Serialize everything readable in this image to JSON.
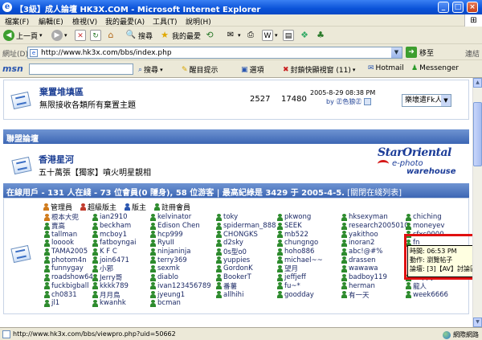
{
  "window": {
    "title": "【3級】成人論壇 HK3X.COM - Microsoft Internet Explorer",
    "buttons": [
      "_",
      "□",
      "×"
    ]
  },
  "menu": [
    "檔案(F)",
    "編輯(E)",
    "檢視(V)",
    "我的最愛(A)",
    "工具(T)",
    "說明(H)"
  ],
  "toolbar": {
    "back": "上一頁",
    "search": "搜尋",
    "favorites": "我的最愛"
  },
  "address": {
    "label": "網址(D)",
    "url": "http://www.hk3x.com/bbs/index.php",
    "go": "移至",
    "links": "連結"
  },
  "msn": {
    "logo": "msn",
    "search": "搜尋",
    "highlight": "醒目提示",
    "options": "選項",
    "popup": "封鎖快顯視窗 (11)",
    "hotmail": "Hotmail",
    "messenger": "Messenger"
  },
  "forums": [
    {
      "title": "棄置堆填區",
      "desc": "無限接收各類所有棄置主題",
      "topics": "2527",
      "posts": "17480",
      "last_time": "2005-8-29 08:38 PM",
      "last_by": "by ㊣色狼㊣",
      "moderator": "樂壞遣Fk人"
    }
  ],
  "section": {
    "title": "聯盟論壇"
  },
  "alliance": {
    "title": "香港星河",
    "desc": "五十萬張【獨家】噴火明星靚相",
    "banner_line1": "StarOriental",
    "banner_line2": "e-photo",
    "banner_line3": "warehouse"
  },
  "online": {
    "header": "在線用戶 - 131 人在綫 - 73 位會員(0 隱身), 58 位游客 | 最高紀綠是 3429 于 2005-4-5.",
    "toggle": "[關閉在綫列表]",
    "legend": [
      "管理員",
      "超級版主",
      "版主",
      "註冊會員"
    ],
    "columns": [
      [
        "根本大兜",
        "賣高",
        "tallman",
        "looook",
        "TAMA2005",
        "photom4n",
        "funnygay",
        "roadshow64",
        "fuckbigball",
        "ch0831",
        "jl1"
      ],
      [
        "ian2910",
        "beckham",
        "mcboy1",
        "fatboyngai",
        "K F C",
        "join6471",
        "小邪",
        "Jerry哥",
        "kkkk789",
        "月月鳥",
        "kwanhk"
      ],
      [
        "kelvinator",
        "Edison Chen",
        "hcp999",
        "RyuII",
        "ninjaninja",
        "terry369",
        "sexmk",
        "diablo",
        "ivan123456789",
        "jyeung1",
        "bcman"
      ],
      [
        "toky",
        "spiderman_888",
        "CHONGKS",
        "d2sky",
        "0s型o0",
        "yuppies",
        "GordonK",
        "BookerT",
        "番薯",
        "allhihi",
        ""
      ],
      [
        "pkwong",
        "SEEK",
        "mb522",
        "chungngo",
        "hoho886",
        "michael~~",
        "望月",
        "jeffjeff",
        "fu~*",
        "goodday",
        ""
      ],
      [
        "hksexyman",
        "research2005010",
        "yakithoo",
        "inoran2",
        "abc!@#%",
        "drassen",
        "wawawa",
        "badboy119",
        "herman",
        "有一天",
        ""
      ],
      [
        "chiching",
        "moneyev",
        "sfxc0000",
        "fn",
        "",
        "",
        "",
        "ffappy88420",
        "龍人",
        "week6666",
        ""
      ]
    ]
  },
  "tooltip": {
    "time": "時間: 06:53 PM",
    "action": "動作: 瀏覽帖子",
    "forum": "論壇: [3]【AV】討論區"
  },
  "status": {
    "url": "http://www.hk3x.com/bbs/viewpro.php?uid=50662",
    "zone": "網際網路"
  }
}
